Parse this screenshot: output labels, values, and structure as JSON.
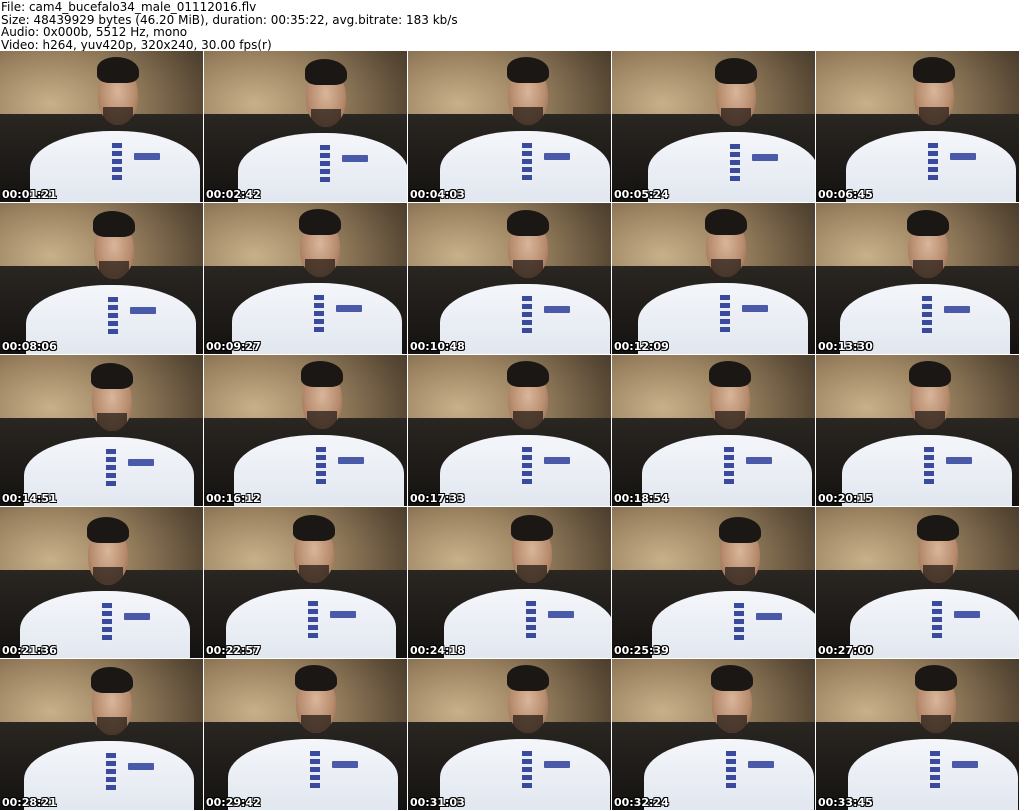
{
  "header": {
    "file_line": "File: cam4_bucefalo34_male_01112016.flv",
    "size_line": "Size: 48439929 bytes (46.20 MiB), duration: 00:35:22, avg.bitrate: 183 kb/s",
    "audio_line": "Audio: 0x000b, 5512 Hz, mono",
    "video_line": "Video: h264, yuv420p, 320x240, 30.00 fps(r)"
  },
  "thumbnails": [
    {
      "time": "00:01:21"
    },
    {
      "time": "00:02:42"
    },
    {
      "time": "00:04:03"
    },
    {
      "time": "00:05:24"
    },
    {
      "time": "00:06:45"
    },
    {
      "time": "00:08:06"
    },
    {
      "time": "00:09:27"
    },
    {
      "time": "00:10:48"
    },
    {
      "time": "00:12:09"
    },
    {
      "time": "00:13:30"
    },
    {
      "time": "00:14:51"
    },
    {
      "time": "00:16:12"
    },
    {
      "time": "00:17:33"
    },
    {
      "time": "00:18:54"
    },
    {
      "time": "00:20:15"
    },
    {
      "time": "00:21:36"
    },
    {
      "time": "00:22:57"
    },
    {
      "time": "00:24:18"
    },
    {
      "time": "00:25:39"
    },
    {
      "time": "00:27:00"
    },
    {
      "time": "00:28:21"
    },
    {
      "time": "00:29:42"
    },
    {
      "time": "00:31:03"
    },
    {
      "time": "00:32:24"
    },
    {
      "time": "00:33:45"
    }
  ]
}
